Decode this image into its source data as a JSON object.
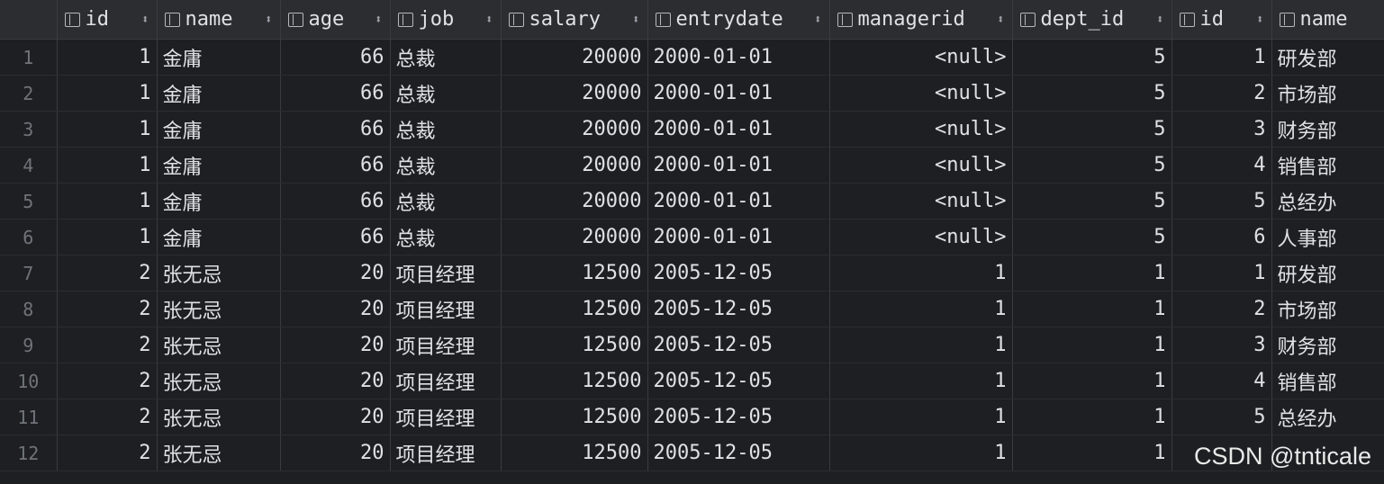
{
  "columns": [
    {
      "label": "id"
    },
    {
      "label": "name"
    },
    {
      "label": "age"
    },
    {
      "label": "job"
    },
    {
      "label": "salary"
    },
    {
      "label": "entrydate"
    },
    {
      "label": "managerid"
    },
    {
      "label": "dept_id"
    },
    {
      "label": "id"
    },
    {
      "label": "name"
    }
  ],
  "rows": [
    {
      "n": "1",
      "id": "1",
      "name": "金庸",
      "age": "66",
      "job": "总裁",
      "salary": "20000",
      "entrydate": "2000-01-01",
      "managerid": "<null>",
      "dept_id": "5",
      "dept_id2": "1",
      "dept_name": "研发部"
    },
    {
      "n": "2",
      "id": "1",
      "name": "金庸",
      "age": "66",
      "job": "总裁",
      "salary": "20000",
      "entrydate": "2000-01-01",
      "managerid": "<null>",
      "dept_id": "5",
      "dept_id2": "2",
      "dept_name": "市场部"
    },
    {
      "n": "3",
      "id": "1",
      "name": "金庸",
      "age": "66",
      "job": "总裁",
      "salary": "20000",
      "entrydate": "2000-01-01",
      "managerid": "<null>",
      "dept_id": "5",
      "dept_id2": "3",
      "dept_name": "财务部"
    },
    {
      "n": "4",
      "id": "1",
      "name": "金庸",
      "age": "66",
      "job": "总裁",
      "salary": "20000",
      "entrydate": "2000-01-01",
      "managerid": "<null>",
      "dept_id": "5",
      "dept_id2": "4",
      "dept_name": "销售部"
    },
    {
      "n": "5",
      "id": "1",
      "name": "金庸",
      "age": "66",
      "job": "总裁",
      "salary": "20000",
      "entrydate": "2000-01-01",
      "managerid": "<null>",
      "dept_id": "5",
      "dept_id2": "5",
      "dept_name": "总经办"
    },
    {
      "n": "6",
      "id": "1",
      "name": "金庸",
      "age": "66",
      "job": "总裁",
      "salary": "20000",
      "entrydate": "2000-01-01",
      "managerid": "<null>",
      "dept_id": "5",
      "dept_id2": "6",
      "dept_name": "人事部"
    },
    {
      "n": "7",
      "id": "2",
      "name": "张无忌",
      "age": "20",
      "job": "项目经理",
      "salary": "12500",
      "entrydate": "2005-12-05",
      "managerid": "1",
      "dept_id": "1",
      "dept_id2": "1",
      "dept_name": "研发部"
    },
    {
      "n": "8",
      "id": "2",
      "name": "张无忌",
      "age": "20",
      "job": "项目经理",
      "salary": "12500",
      "entrydate": "2005-12-05",
      "managerid": "1",
      "dept_id": "1",
      "dept_id2": "2",
      "dept_name": "市场部"
    },
    {
      "n": "9",
      "id": "2",
      "name": "张无忌",
      "age": "20",
      "job": "项目经理",
      "salary": "12500",
      "entrydate": "2005-12-05",
      "managerid": "1",
      "dept_id": "1",
      "dept_id2": "3",
      "dept_name": "财务部"
    },
    {
      "n": "10",
      "id": "2",
      "name": "张无忌",
      "age": "20",
      "job": "项目经理",
      "salary": "12500",
      "entrydate": "2005-12-05",
      "managerid": "1",
      "dept_id": "1",
      "dept_id2": "4",
      "dept_name": "销售部"
    },
    {
      "n": "11",
      "id": "2",
      "name": "张无忌",
      "age": "20",
      "job": "项目经理",
      "salary": "12500",
      "entrydate": "2005-12-05",
      "managerid": "1",
      "dept_id": "1",
      "dept_id2": "5",
      "dept_name": "总经办"
    },
    {
      "n": "12",
      "id": "2",
      "name": "张无忌",
      "age": "20",
      "job": "项目经理",
      "salary": "12500",
      "entrydate": "2005-12-05",
      "managerid": "1",
      "dept_id": "1",
      "dept_id2": "",
      "dept_name": ""
    }
  ],
  "watermark": "CSDN @tnticale",
  "icons": {
    "column": "column-icon",
    "sort": "sort-icon"
  },
  "colors": {
    "background": "#1e1f22",
    "header_bg": "#2b2d30",
    "text": "#dfe1e5",
    "null_text": "#7a7e85",
    "row_number": "#6f737a"
  }
}
